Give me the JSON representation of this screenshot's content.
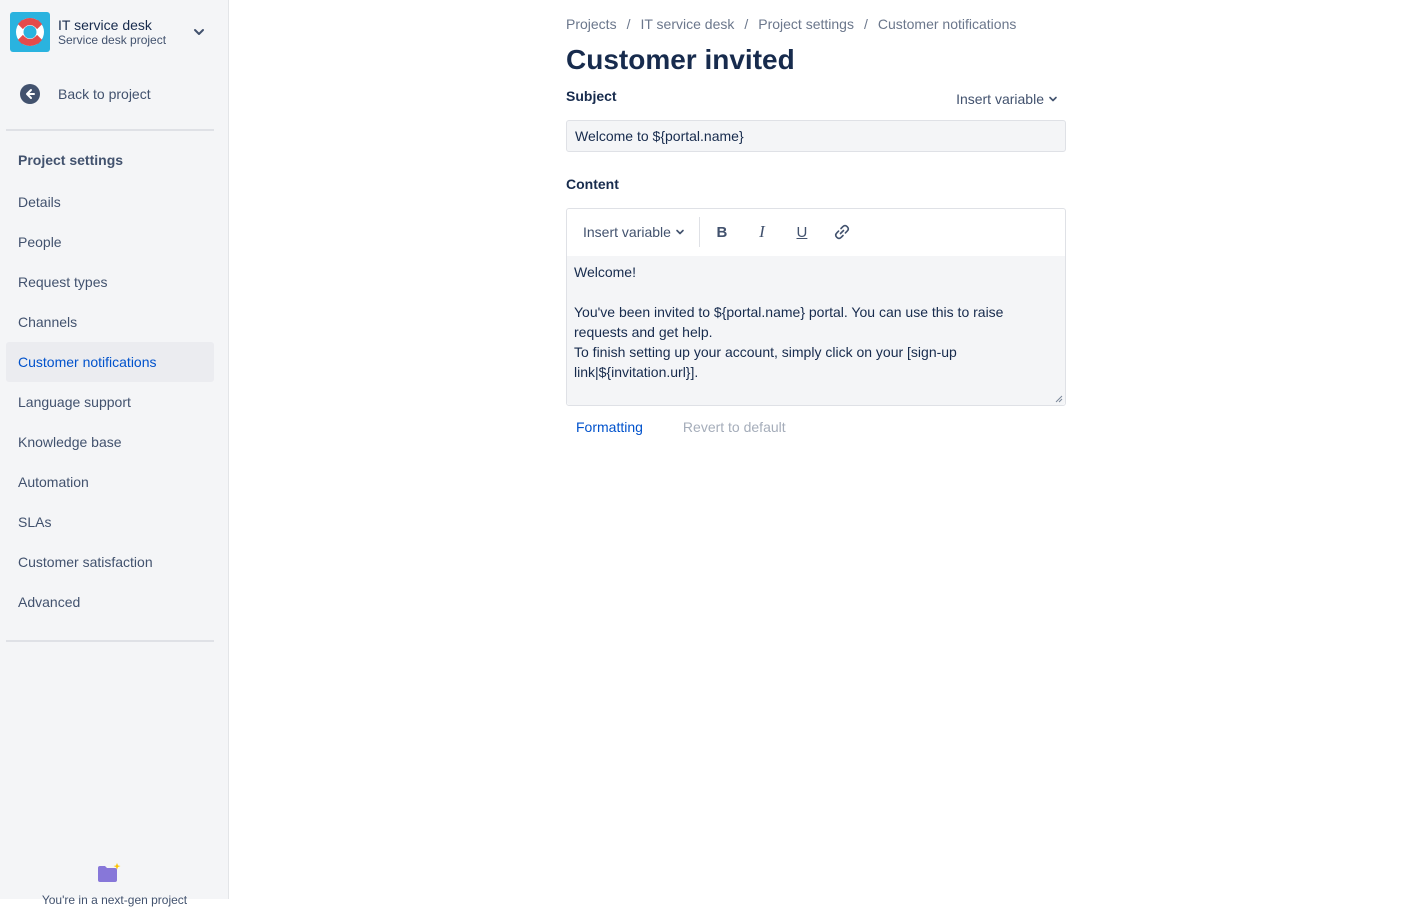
{
  "sidebar": {
    "project_name": "IT service desk",
    "project_type": "Service desk project",
    "back_link": "Back to project",
    "section_title": "Project settings",
    "items": [
      {
        "label": "Details"
      },
      {
        "label": "People"
      },
      {
        "label": "Request types"
      },
      {
        "label": "Channels"
      },
      {
        "label": "Customer notifications",
        "active": true
      },
      {
        "label": "Language support"
      },
      {
        "label": "Knowledge base"
      },
      {
        "label": "Automation"
      },
      {
        "label": "SLAs"
      },
      {
        "label": "Customer satisfaction"
      },
      {
        "label": "Advanced"
      }
    ],
    "bottom_text": "You're in a next-gen project"
  },
  "breadcrumb": [
    "Projects",
    "IT service desk",
    "Project settings",
    "Customer notifications"
  ],
  "page": {
    "title": "Customer invited",
    "subject_label": "Subject",
    "insert_variable": "Insert variable",
    "subject_value": "Welcome to ${portal.name}",
    "content_label": "Content",
    "toolbar": {
      "insert_variable": "Insert variable",
      "bold": "B",
      "italic": "I",
      "underline": "U"
    },
    "content_text": "Welcome!\n\nYou've been invited to ${portal.name} portal. You can use this to raise requests and get help.\nTo finish setting up your account, simply click on your [sign-up link|${invitation.url}].",
    "formatting_link": "Formatting",
    "revert_link": "Revert to default"
  },
  "colors": {
    "accent": "#0052cc",
    "sidebar_bg": "#f4f5f7",
    "avatar_bg": "#2ab3df",
    "text": "#172b4d"
  }
}
